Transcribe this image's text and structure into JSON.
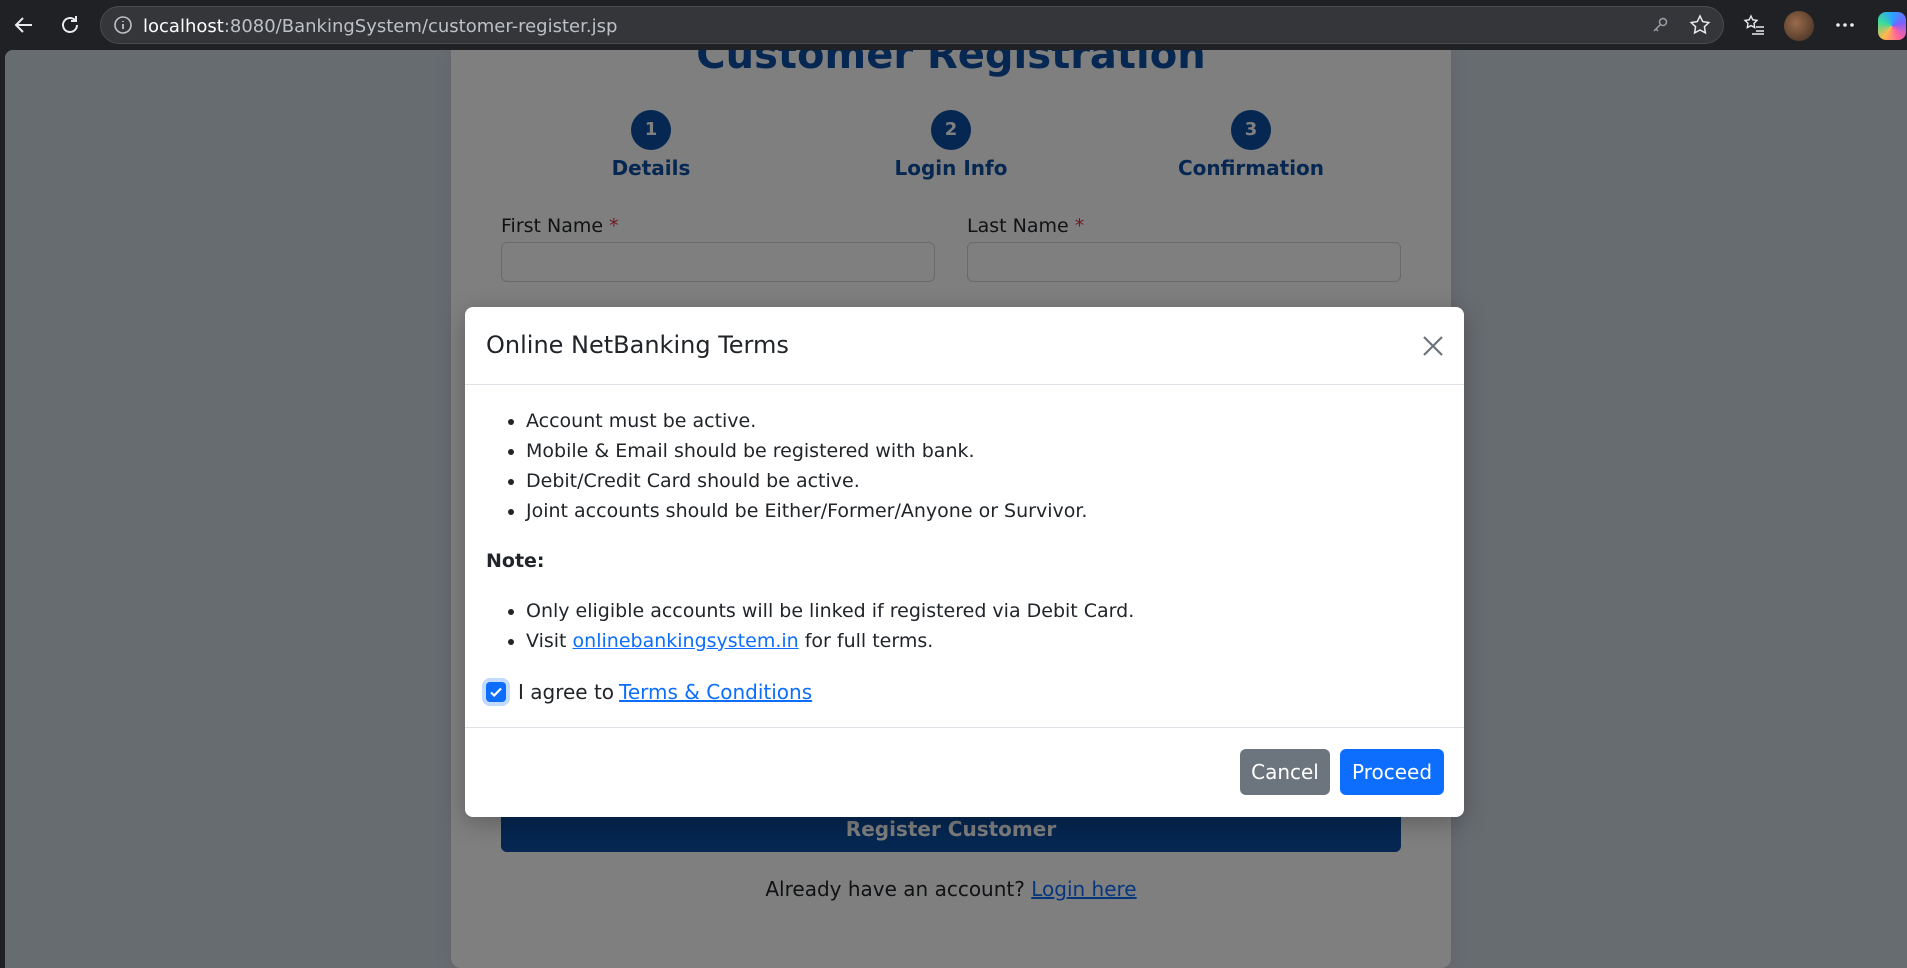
{
  "browser": {
    "url_host": "localhost",
    "url_rest": ":8080/BankingSystem/customer-register.jsp"
  },
  "page": {
    "title": "Customer Registration",
    "steps": [
      {
        "number": "1",
        "label": "Details"
      },
      {
        "number": "2",
        "label": "Login Info"
      },
      {
        "number": "3",
        "label": "Confirmation"
      }
    ],
    "fields": {
      "first_name_label": "First Name",
      "last_name_label": "Last Name",
      "required_marker": "*"
    },
    "register_button": "Register Customer",
    "login_prompt": "Already have an account?",
    "login_link": "Login here"
  },
  "modal": {
    "title": "Online NetBanking Terms",
    "requirements": [
      "Account must be active.",
      "Mobile & Email should be registered with bank.",
      "Debit/Credit Card should be active.",
      "Joint accounts should be Either/Former/Anyone or Survivor."
    ],
    "note_heading": "Note:",
    "note_item_1": "Only eligible accounts will be linked if registered via Debit Card.",
    "note_item_2_prefix": "Visit",
    "note_item_2_link": "onlinebankingsystem.in",
    "note_item_2_suffix": "for full terms.",
    "agree_text": "I agree to",
    "agree_link": "Terms & Conditions",
    "agree_checked": true,
    "cancel_label": "Cancel",
    "proceed_label": "Proceed"
  },
  "colors": {
    "primary": "#0d6efd",
    "brand_dark": "#0a4fa3",
    "secondary": "#6c757d"
  }
}
